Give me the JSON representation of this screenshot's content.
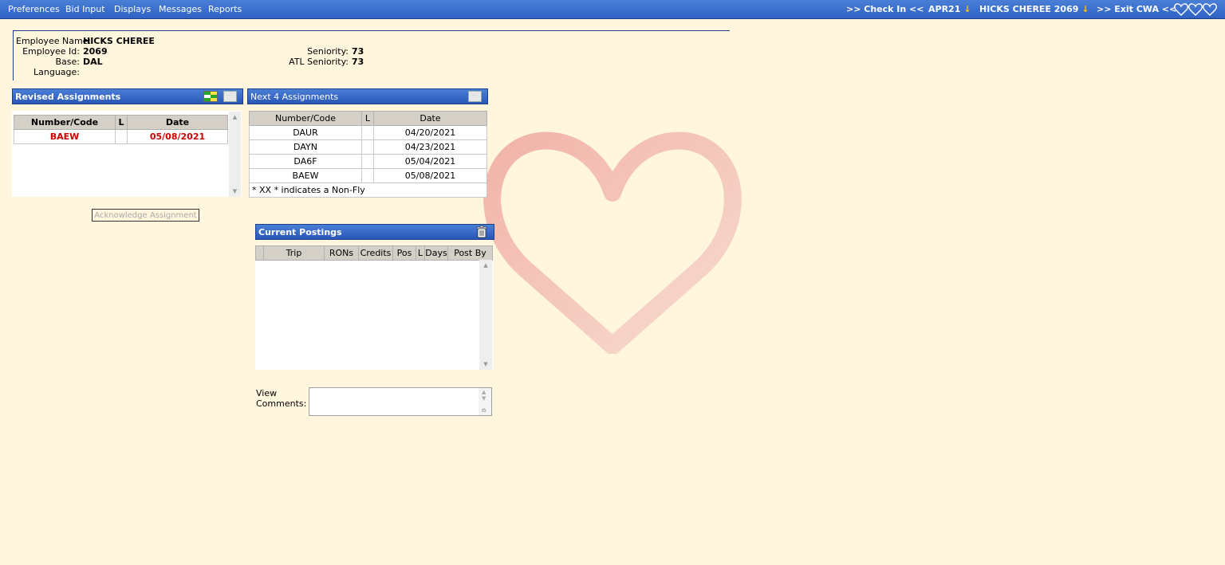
{
  "topbar": {
    "menu": [
      "Preferences",
      "Bid Input",
      "Displays",
      "Messages",
      "Reports"
    ],
    "check_in": ">> Check In <<",
    "period": "APR21",
    "user": "HICKS CHEREE 2069",
    "exit": ">> Exit CWA <<"
  },
  "employee": {
    "name_label": "Employee Name:",
    "name": "HICKS CHEREE",
    "id_label": "Employee Id:",
    "id": "2069",
    "base_label": "Base:",
    "base": "DAL",
    "language_label": "Language:",
    "language": "",
    "seniority_label": "Seniority:",
    "seniority": "73",
    "atl_seniority_label": "ATL Seniority:",
    "atl_seniority": "73"
  },
  "revised": {
    "title": "Revised Assignments",
    "headers": [
      "Number/Code",
      "L",
      "Date"
    ],
    "rows": [
      {
        "code": "BAEW",
        "l": "",
        "date": "05/08/2021"
      }
    ],
    "ack_button": "Acknowledge Assignment"
  },
  "next4": {
    "title": "Next 4 Assignments",
    "headers": [
      "Number/Code",
      "L",
      "Date"
    ],
    "rows": [
      {
        "code": "DAUR",
        "l": "",
        "date": "04/20/2021"
      },
      {
        "code": "DAYN",
        "l": "",
        "date": "04/23/2021"
      },
      {
        "code": "DA6F",
        "l": "",
        "date": "05/04/2021"
      },
      {
        "code": "BAEW",
        "l": "",
        "date": "05/08/2021"
      }
    ],
    "footnote": "* XX * indicates a Non-Fly"
  },
  "postings": {
    "title": "Current Postings",
    "headers": [
      "Trip",
      "RONs",
      "Credits",
      "Pos",
      "L",
      "Days",
      "Post By"
    ]
  },
  "comments": {
    "label_line1": "View",
    "label_line2": "Comments:",
    "value": ""
  },
  "colors": {
    "header_blue": "#2f62c4",
    "background": "#fff6dd",
    "revised_text": "#cc0000",
    "arrow": "#ffc21a"
  },
  "icons": [
    "heart-outline-icon",
    "arrow-right-icon",
    "grid-toggle-icon",
    "trash-icon",
    "down-arrow-icon"
  ]
}
